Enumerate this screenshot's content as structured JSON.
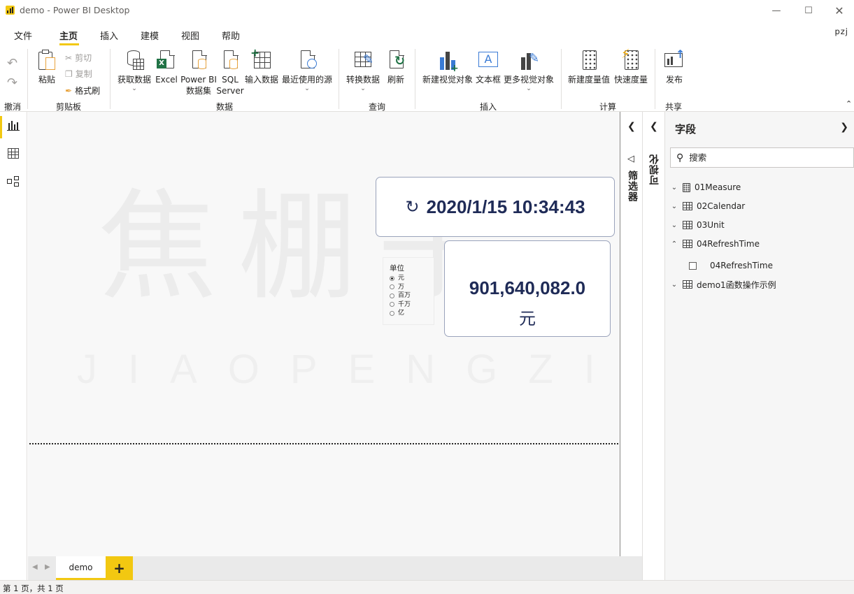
{
  "window": {
    "title": "demo - Power BI Desktop",
    "user": "pzj"
  },
  "menu": {
    "tabs": [
      {
        "label": "文件"
      },
      {
        "label": "主页"
      },
      {
        "label": "插入"
      },
      {
        "label": "建模"
      },
      {
        "label": "视图"
      },
      {
        "label": "帮助"
      }
    ],
    "active": "主页"
  },
  "ribbon": {
    "undo_group": "撤消",
    "clipboard": {
      "group": "剪贴板",
      "paste": "粘贴",
      "cut": "剪切",
      "copy": "复制",
      "format_painter": "格式刷"
    },
    "data": {
      "group": "数据",
      "get_data": "获取数据",
      "excel": "Excel",
      "pbi_line1": "Power BI",
      "pbi_line2": "数据集",
      "sql_line1": "SQL",
      "sql_line2": "Server",
      "enter_data": "输入数据",
      "recent_sources": "最近使用的源"
    },
    "query": {
      "group": "查询",
      "transform": "转换数据",
      "refresh": "刷新"
    },
    "insert": {
      "group": "插入",
      "new_visual": "新建视觉对象",
      "text_box": "文本框",
      "more_visuals": "更多视觉对象"
    },
    "calc": {
      "group": "计算",
      "new_measure": "新建度量值",
      "quick_measure": "快速度量"
    },
    "share": {
      "group": "共享",
      "publish": "发布"
    }
  },
  "canvas": {
    "watermark_cn": "焦棚子",
    "watermark_en": "JIAOPENGZI",
    "refresh_time": "2020/1/15 10:34:43",
    "value": "901,640,082.0",
    "value_unit": "元",
    "slicer": {
      "title": "单位",
      "options": [
        "元",
        "万",
        "百万",
        "千万",
        "亿"
      ],
      "selected": "元"
    }
  },
  "pages": {
    "tabs": [
      "demo"
    ],
    "add": "+"
  },
  "filters_pane": {
    "label": "筛选器"
  },
  "viz_pane": {
    "label": "可视化"
  },
  "fields": {
    "title": "字段",
    "search_placeholder": "搜索",
    "tables": [
      {
        "name": "01Measure",
        "expanded": false,
        "icon": "calculator-icon"
      },
      {
        "name": "02Calendar",
        "expanded": false,
        "icon": "table-icon"
      },
      {
        "name": "03Unit",
        "expanded": false,
        "icon": "table-icon"
      },
      {
        "name": "04RefreshTime",
        "expanded": true,
        "icon": "table-icon"
      },
      {
        "name": "04RefreshTime",
        "child": true
      },
      {
        "name": "demo1函数操作示例",
        "expanded": false,
        "icon": "table-icon"
      }
    ]
  },
  "status": {
    "text": "第 1 页，共 1 页"
  },
  "colors": {
    "accent": "#f2c811",
    "card_text": "#1f2b57",
    "card_border": "#9aa3bb"
  }
}
